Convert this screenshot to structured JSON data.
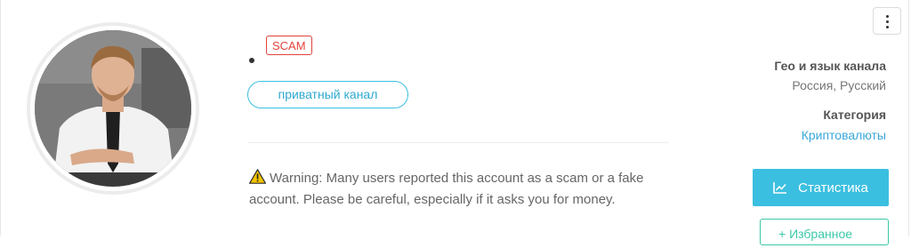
{
  "channel": {
    "scam_badge": "SCAM",
    "private_label": "приватный канал",
    "warning_text": "Warning: Many users reported this account as a scam or a fake account. Please be careful, especially if it asks you for money."
  },
  "sidebar": {
    "geo_label": "Гео и язык канала",
    "geo_value": "Россия, Русский",
    "category_label": "Категория",
    "category_value": "Криптовалюты",
    "stats_button": "Статистика",
    "favorite_button": "+ Избранное"
  },
  "colors": {
    "accent": "#3bbfe0",
    "scam": "#e2423b",
    "link": "#3aa8d8",
    "favorite": "#3bc9a9"
  },
  "icons": {
    "menu": "more-vertical-icon",
    "warning": "warning-icon",
    "stats": "chart-line-icon"
  }
}
